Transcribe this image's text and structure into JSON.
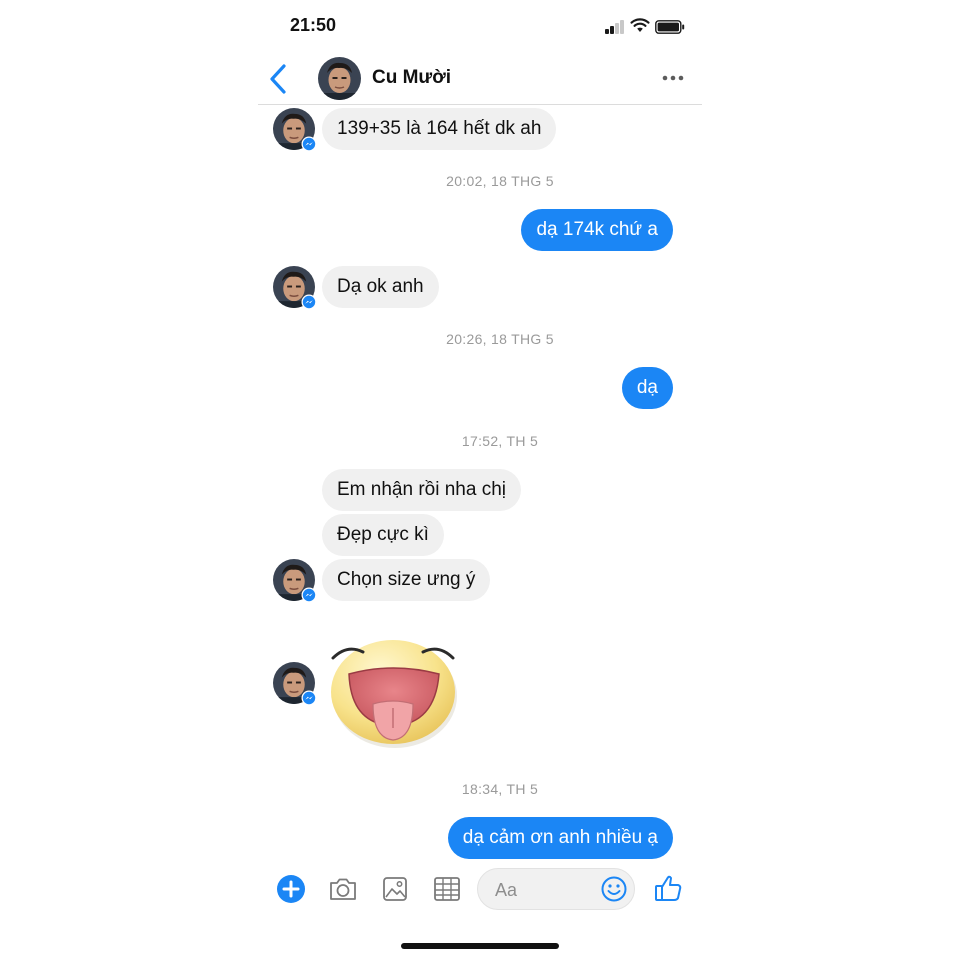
{
  "status_bar": {
    "time": "21:50"
  },
  "header": {
    "contact_name": "Cu Mười",
    "back_icon": "chevron-left-icon",
    "more_icon": "more-dots-icon"
  },
  "colors": {
    "accent": "#1b86f5",
    "incoming_bubble": "#f0f0f0",
    "timestamp": "#9a9a9a"
  },
  "thread": {
    "msg1": "139+35 là 164 hết dk ah",
    "ts1": "20:02, 18 THG 5",
    "msg2": "dạ 174k chứ a",
    "msg3": "Dạ ok anh",
    "ts2": "20:26, 18 THG 5",
    "msg4": "dạ",
    "ts3": "17:52, TH 5",
    "msg5": "Em nhận rồi nha chị",
    "msg6": "Đẹp cực kì",
    "msg7": "Chọn size ưng ý",
    "sticker": "tongue-out-emoji-sticker",
    "ts4": "18:34, TH 5",
    "msg8": "dạ cảm ơn anh nhiều ạ"
  },
  "composer": {
    "placeholder": "Aa",
    "icons": [
      "plus-icon",
      "camera-icon",
      "image-icon",
      "grid-icon",
      "smiley-icon",
      "thumbs-up-icon"
    ]
  }
}
